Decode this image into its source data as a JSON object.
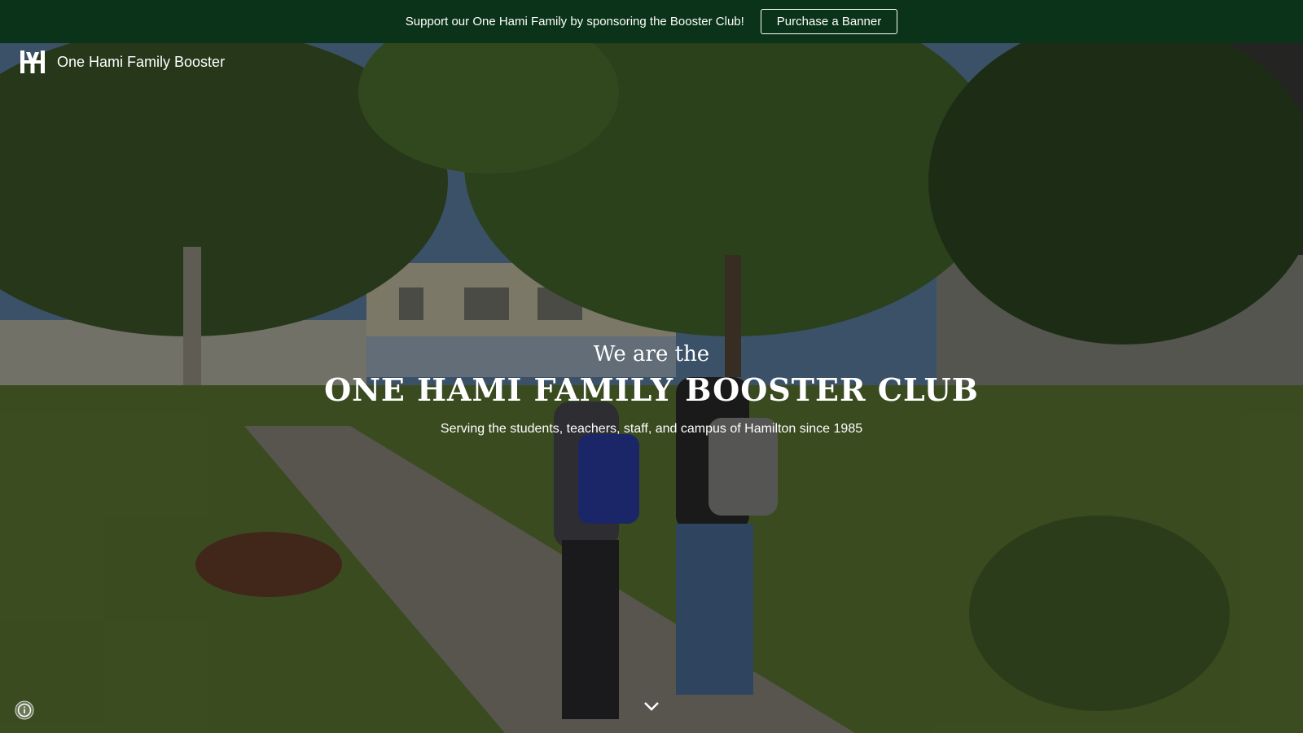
{
  "announcement": {
    "text": "Support our One Hami Family by sponsoring the Booster Club!",
    "button_label": "Purchase a Banner"
  },
  "header": {
    "site_title": "One Hami Family Booster",
    "logo_icon": "hm-monogram-icon"
  },
  "hero": {
    "kicker": "We are the",
    "headline": "ONE HAMI FAMILY BOOSTER CLUB",
    "subline": "Serving the students, teachers, staff, and campus of Hamilton since 1985",
    "scroll_icon": "chevron-down-icon"
  },
  "footer": {
    "info_icon": "info-icon"
  },
  "colors": {
    "announcement_bg": "#0b3319",
    "text": "#ffffff"
  }
}
